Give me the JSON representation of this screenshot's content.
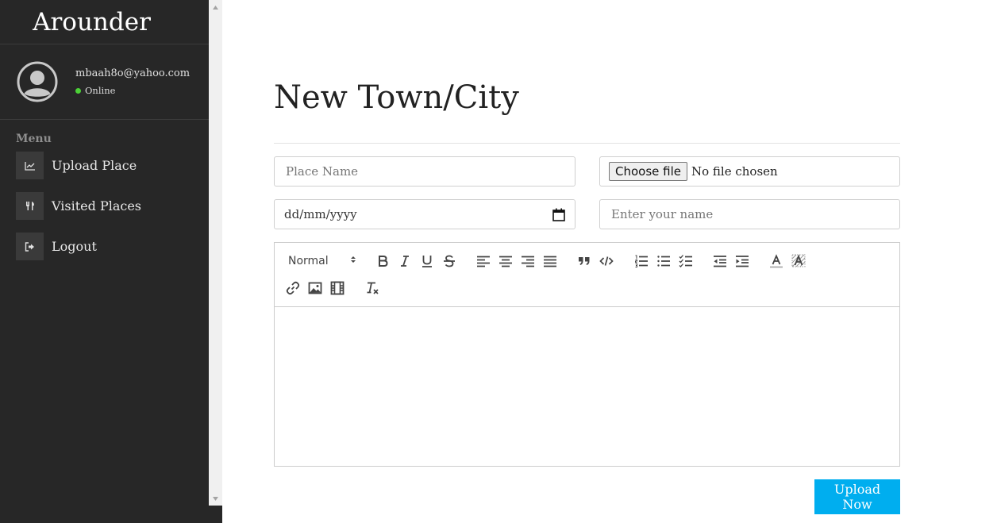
{
  "sidebar": {
    "brand": "Arounder",
    "user": {
      "email": "mbaah8o@yahoo.com",
      "status": "Online",
      "status_color": "#4cd137"
    },
    "menu_title": "Menu",
    "items": [
      {
        "label": "Upload Place",
        "icon": "chart-line-icon"
      },
      {
        "label": "Visited Places",
        "icon": "utensils-icon"
      },
      {
        "label": "Logout",
        "icon": "sign-out-icon"
      }
    ]
  },
  "main": {
    "title": "New Town/City",
    "place_name_placeholder": "Place Name",
    "file_button_label": "Choose file",
    "file_status": "No file chosen",
    "date_value": "dd/mm/yyyy",
    "name_placeholder": "Enter your name",
    "editor": {
      "heading_value": "Normal",
      "tools": [
        "bold",
        "italic",
        "underline",
        "strike",
        "align-left",
        "align-center",
        "align-right",
        "align-justify",
        "blockquote",
        "code",
        "ordered-list",
        "bullet-list",
        "check-list",
        "outdent",
        "indent",
        "text-color",
        "background-color",
        "link",
        "image",
        "video",
        "clear-format"
      ]
    },
    "submit_label": "Upload Now",
    "accent_color": "#00aeef"
  }
}
